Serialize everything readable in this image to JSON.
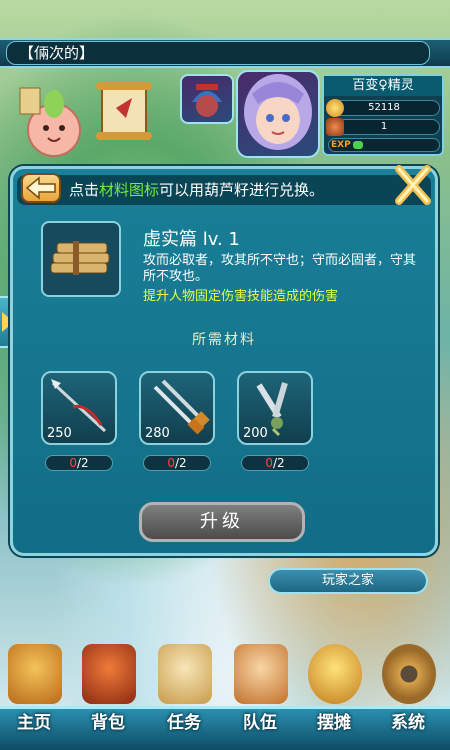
{
  "chat": {
    "text": "【倆次的】"
  },
  "player": {
    "name": "百变♀精灵",
    "gold": "52118",
    "items": "1",
    "exp_label": "EXP"
  },
  "panel": {
    "hint_pre": "点击",
    "hint_green": "材料图标",
    "hint_post": "可以用葫芦籽进行兑换。",
    "skill_name": "虚实篇 lv. 1",
    "skill_desc": "攻而必取者，攻其所不守也；守而必固者，守其所不攻也。",
    "skill_effect": "提升人物固定伤害技能造成的伤害",
    "section_title": "所需材料",
    "materials": [
      {
        "cost": "250",
        "have": "0",
        "need": "/2"
      },
      {
        "cost": "280",
        "have": "0",
        "need": "/2"
      },
      {
        "cost": "200",
        "have": "0",
        "need": "/2"
      }
    ],
    "upgrade_label": "升级"
  },
  "player_home": "玩家之家",
  "nav": [
    {
      "label": "主页",
      "icon": "house-icon"
    },
    {
      "label": "背包",
      "icon": "chest-icon"
    },
    {
      "label": "任务",
      "icon": "scroll-icon"
    },
    {
      "label": "队伍",
      "icon": "team-icon"
    },
    {
      "label": "摆摊",
      "icon": "coin-icon"
    },
    {
      "label": "系统",
      "icon": "gear-icon"
    }
  ],
  "colors": {
    "accent": "#8fd3df",
    "hint_green": "#74ec3b",
    "effect_yellow": "#eaff3a",
    "count_red": "#ff4343"
  }
}
